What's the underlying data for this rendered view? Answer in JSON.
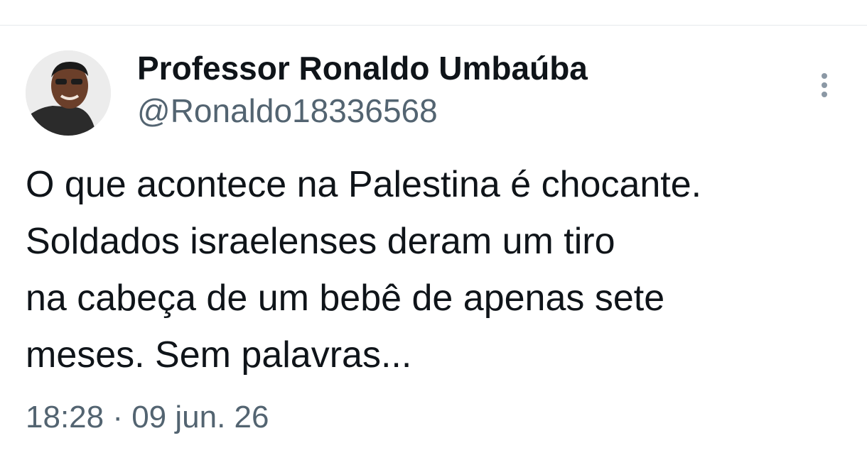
{
  "tweet": {
    "author": {
      "display_name": "Professor Ronaldo Umbaúba",
      "handle": "@Ronaldo18336568",
      "avatar_icon": "profile-photo"
    },
    "text_lines": [
      "O que acontece na Palestina é chocante.",
      "Soldados israelenses deram um tiro",
      "na cabeça de um bebê de apenas sete",
      "meses. Sem palavras..."
    ],
    "timestamp": "18:28 · 09 jun. 26",
    "more_icon": "more-vertical-icon"
  },
  "colors": {
    "text_primary": "#0f1419",
    "text_secondary": "#536471",
    "divider": "#e6e9ec",
    "icon": "#8b98a5"
  }
}
